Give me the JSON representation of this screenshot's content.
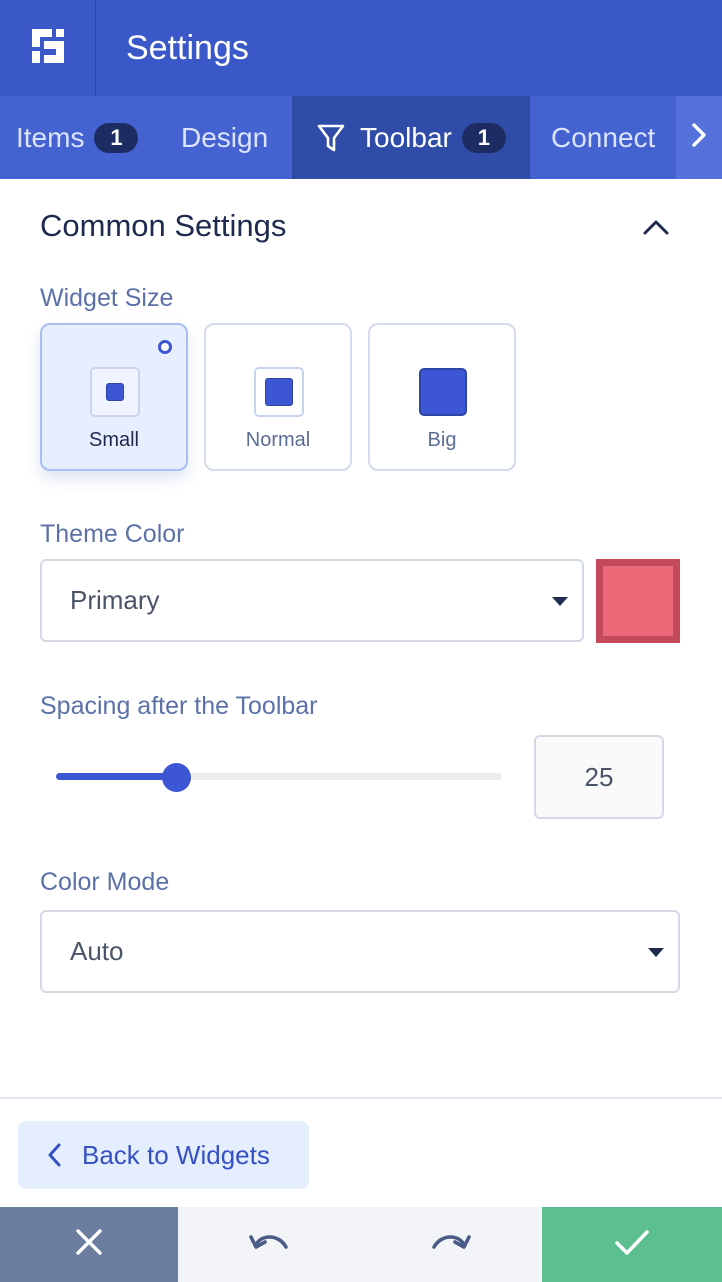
{
  "header": {
    "title": "Settings",
    "logo_icon": "app-logo-icon"
  },
  "tabs": [
    {
      "label": "Items",
      "badge": "1",
      "active": false
    },
    {
      "label": "Design",
      "badge": null,
      "active": false
    },
    {
      "label": "Toolbar",
      "badge": "1",
      "active": true,
      "icon": "filter-icon"
    },
    {
      "label": "Connect",
      "badge": null,
      "active": false
    }
  ],
  "tabs_next_icon": "chevron-right-icon",
  "section": {
    "title": "Common Settings",
    "collapse_icon": "chevron-up-icon"
  },
  "widget_size": {
    "label": "Widget Size",
    "options": [
      {
        "label": "Small",
        "selected": true
      },
      {
        "label": "Normal",
        "selected": false
      },
      {
        "label": "Big",
        "selected": false
      }
    ]
  },
  "theme_color": {
    "label": "Theme Color",
    "value": "Primary",
    "swatch_color": "#eb6878",
    "swatch_border": "#c44a5a"
  },
  "spacing": {
    "label": "Spacing after the Toolbar",
    "value": "25"
  },
  "color_mode": {
    "label": "Color Mode",
    "value": "Auto"
  },
  "footer": {
    "back_label": "Back to Widgets",
    "cancel_icon": "close-icon",
    "undo_icon": "undo-icon",
    "redo_icon": "redo-icon",
    "save_icon": "check-icon"
  },
  "colors": {
    "header_bg": "#3a58c8",
    "accent": "#3d57d4",
    "save_green": "#5bbf8f",
    "cancel_gray": "#6b7ea0"
  }
}
